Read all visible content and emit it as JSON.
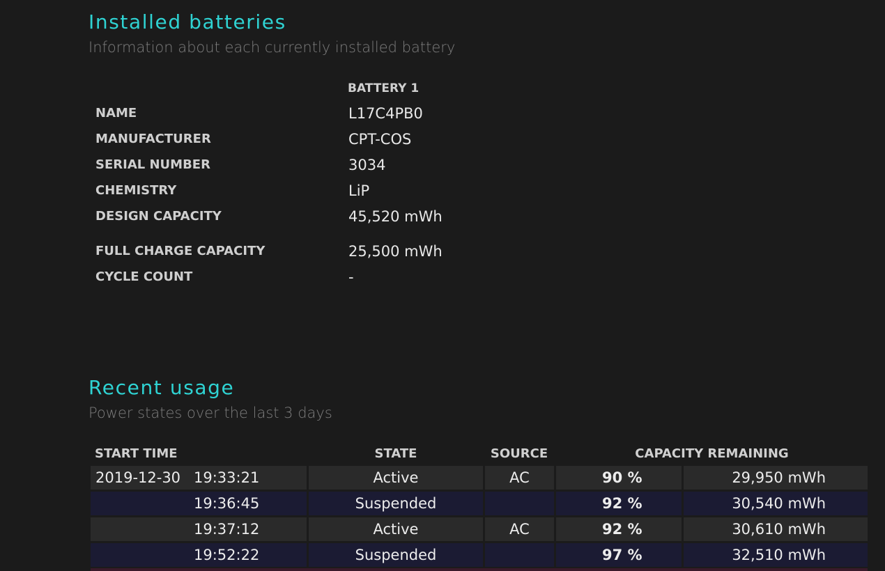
{
  "installed": {
    "title": "Installed batteries",
    "subtitle": "Information about each currently installed battery",
    "column_header": "BATTERY 1",
    "rows": [
      {
        "label": "NAME",
        "value": "L17C4PB0"
      },
      {
        "label": "MANUFACTURER",
        "value": "CPT-COS"
      },
      {
        "label": "SERIAL NUMBER",
        "value": "3034"
      },
      {
        "label": "CHEMISTRY",
        "value": "LiP"
      },
      {
        "label": "DESIGN CAPACITY",
        "value": "45,520 mWh"
      },
      {
        "label": "FULL CHARGE CAPACITY",
        "value": "25,500 mWh"
      },
      {
        "label": "CYCLE COUNT",
        "value": "-"
      }
    ]
  },
  "recent": {
    "title": "Recent usage",
    "subtitle": "Power states over the last 3 days",
    "headers": {
      "start_time": "START TIME",
      "state": "STATE",
      "source": "SOURCE",
      "capacity": "CAPACITY REMAINING"
    },
    "rows": [
      {
        "date": "2019-12-30",
        "time": "19:33:21",
        "state": "Active",
        "source": "AC",
        "percent": "90 %",
        "mwh": "29,950 mWh"
      },
      {
        "date": "",
        "time": "19:36:45",
        "state": "Suspended",
        "source": "",
        "percent": "92 %",
        "mwh": "30,540 mWh"
      },
      {
        "date": "",
        "time": "19:37:12",
        "state": "Active",
        "source": "AC",
        "percent": "92 %",
        "mwh": "30,610 mWh"
      },
      {
        "date": "",
        "time": "19:52:22",
        "state": "Suspended",
        "source": "",
        "percent": "97 %",
        "mwh": "32,510 mWh"
      }
    ]
  }
}
